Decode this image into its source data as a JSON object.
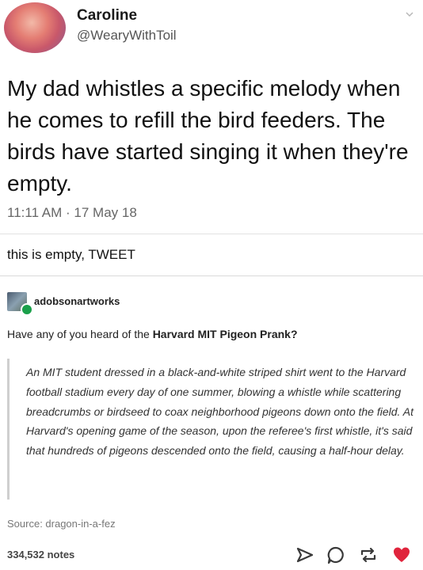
{
  "tweet": {
    "name": "Caroline",
    "handle": "@WearyWithToil",
    "text": "My dad whistles a specific melody when he comes to refill the bird feeders. The birds have started singing it when they're empty.",
    "timestamp": "11:11 AM · 17 May 18",
    "reblog_comment": "this is empty, TWEET"
  },
  "post": {
    "username": "adobsonartworks",
    "question_prefix": "Have any of you heard of the ",
    "question_bold": "Harvard MIT Pigeon Prank?",
    "quote": "An MIT student dressed in a black-and-white striped shirt went to the Harvard football stadium every day of one summer, blowing a whistle while scattering breadcrumbs or birdseed to coax neighborhood pigeons down onto the field. At Harvard's opening game of the season, upon the referee's first whistle, it's said that hundreds of pigeons descended onto the field, causing a half-hour delay.",
    "source": "Source: dragon-in-a-fez",
    "notes": "334,532 notes"
  },
  "icons": {
    "dropdown": "chevron-down-icon",
    "share": "share-icon",
    "reply": "reply-icon",
    "reblog": "reblog-icon",
    "like": "heart-icon"
  },
  "colors": {
    "heart": "#e0243c",
    "badge": "#1aa04a"
  }
}
